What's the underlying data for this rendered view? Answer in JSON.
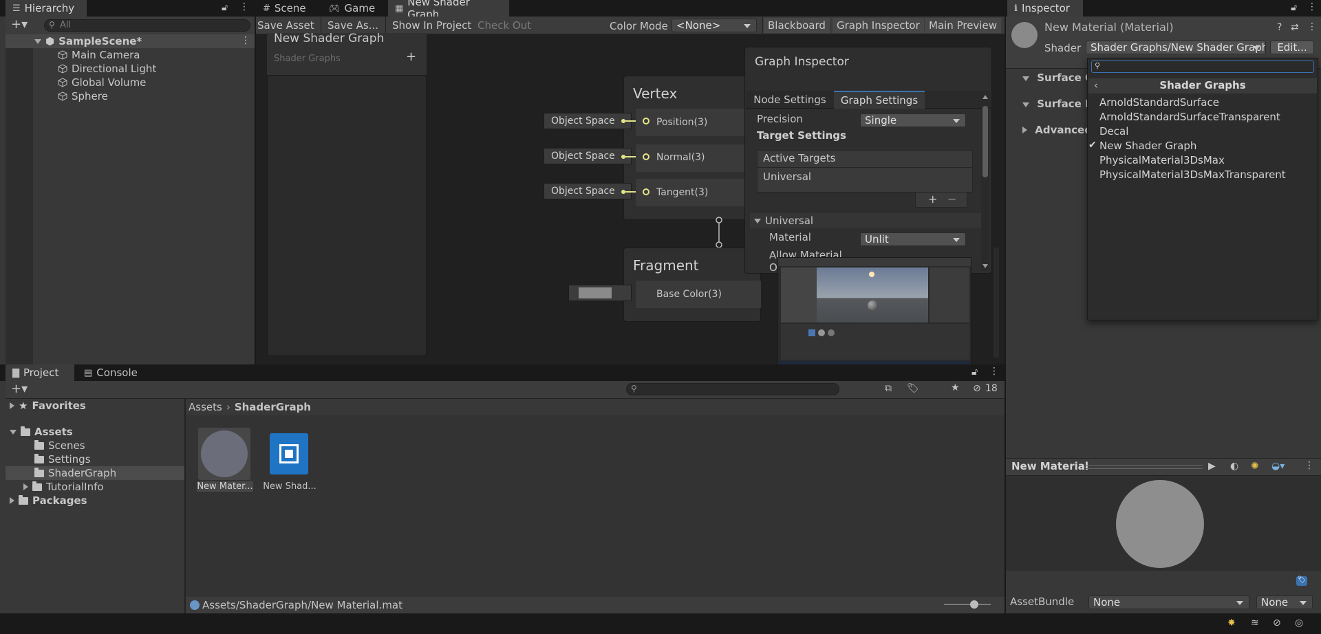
{
  "hierarchy": {
    "tab_label": "Hierarchy",
    "search_placeholder": "All",
    "scene_name": "SampleScene*",
    "items": [
      "Main Camera",
      "Directional Light",
      "Global Volume",
      "Sphere"
    ]
  },
  "center_tabs": {
    "scene": "Scene",
    "game": "Game",
    "shader_graph": "New Shader Graph"
  },
  "graph_toolbar": {
    "save_asset": "Save Asset",
    "save_as": "Save As...",
    "show_in_project": "Show In Project",
    "check_out": "Check Out",
    "color_mode_label": "Color Mode",
    "color_mode_value": "<None>",
    "blackboard": "Blackboard",
    "graph_inspector": "Graph Inspector",
    "main_preview": "Main Preview"
  },
  "blackboard": {
    "title": "New Shader Graph",
    "subtitle": "Shader Graphs",
    "add_symbol": "+"
  },
  "vertex_node": {
    "title": "Vertex",
    "ports": [
      "Position(3)",
      "Normal(3)",
      "Tangent(3)"
    ],
    "inputs": [
      "Object Space",
      "Object Space",
      "Object Space"
    ]
  },
  "fragment_node": {
    "title": "Fragment",
    "ports": [
      "Base Color(3)"
    ]
  },
  "graph_inspector": {
    "title": "Graph Inspector",
    "tabs": [
      "Node Settings",
      "Graph Settings"
    ],
    "precision_label": "Precision",
    "precision_value": "Single",
    "target_settings": "Target Settings",
    "active_targets": "Active Targets",
    "active_target_item": "Universal",
    "universal_section": "Universal",
    "material_label": "Material",
    "material_value": "Unlit",
    "allow_material_label": "Allow Material",
    "allow_material_label_2": "O",
    "add_symbol": "+",
    "remove_symbol": "−"
  },
  "project": {
    "tab_label": "Project",
    "console_tab": "Console",
    "hidden_count": "18",
    "favorites": "Favorites",
    "assets": "Assets",
    "folders": [
      "Scenes",
      "Settings",
      "ShaderGraph",
      "TutorialInfo"
    ],
    "packages": "Packages",
    "breadcrumb_root": "Assets",
    "breadcrumb_current": "ShaderGraph",
    "files": [
      "New Mater...",
      "New Shad..."
    ],
    "status_path": "Assets/ShaderGraph/New Material.mat"
  },
  "inspector": {
    "tab_label": "Inspector",
    "material_name": "New Material (Material)",
    "shader_label": "Shader",
    "shader_value": "Shader Graphs/New Shader Graph",
    "edit_button": "Edit...",
    "sections": [
      "Surface O",
      "Surface In",
      "Advanced"
    ],
    "preview_title": "New Material",
    "asset_bundle_label": "AssetBundle",
    "asset_bundle_value": "None",
    "asset_bundle_variant": "None"
  },
  "shader_menu": {
    "header": "Shader Graphs",
    "items": [
      "ArnoldStandardSurface",
      "ArnoldStandardSurfaceTransparent",
      "Decal",
      "New Shader Graph",
      "PhysicalMaterial3DsMax",
      "PhysicalMaterial3DsMaxTransparent"
    ],
    "checked_index": 3,
    "check_mark": "✔"
  },
  "colors": {
    "background": "#191919",
    "panel": "#383838",
    "graph_bg": "#202020",
    "accent": "#3a72b0",
    "port_yellow": "#e4e48a"
  }
}
